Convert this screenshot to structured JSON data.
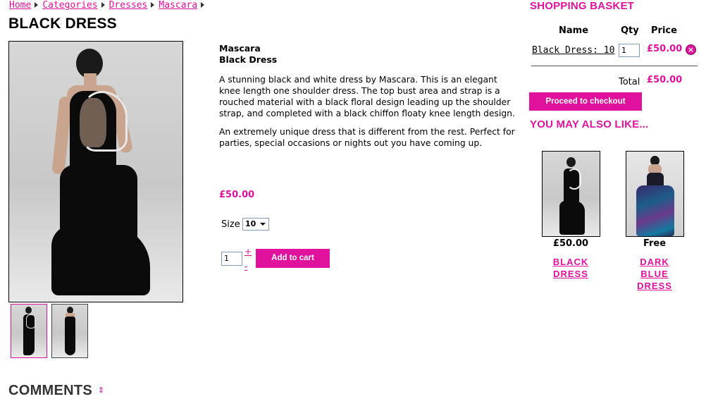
{
  "breadcrumb": {
    "items": [
      "Home",
      "Categories",
      "Dresses",
      "Mascara"
    ]
  },
  "page_title": "BLACK DRESS",
  "product": {
    "brand": "Mascara",
    "name": "Black Dress",
    "description": [
      "A stunning black and white dress by Mascara. This is an elegant knee length one shoulder dress. The top bust area and strap is a rouched material with a black floral design leading up the shoulder strap, and completed with a black chiffon floaty knee length design.",
      "An extremely unique dress that is different from the rest. Perfect for parties, special occasions or nights out you have coming up."
    ],
    "price": "£50.00",
    "size_label": "Size",
    "size_selected": "10",
    "quantity": "1",
    "qty_plus": "+",
    "qty_minus": "-",
    "add_to_cart_label": "Add to cart"
  },
  "comments": {
    "title": "COMMENTS",
    "toggle_icon": "⇕"
  },
  "basket": {
    "title": "SHOPPING BASKET",
    "columns": [
      "Name",
      "Qty",
      "Price"
    ],
    "items": [
      {
        "name": "Black Dress: 10",
        "qty": "1",
        "price": "£50.00"
      }
    ],
    "total_label": "Total",
    "total_value": "£50.00",
    "checkout_label": "Proceed to checkout"
  },
  "also_like": {
    "title": "YOU MAY ALSO LIKE...",
    "items": [
      {
        "price": "£50.00",
        "name_lines": [
          "BLACK",
          "DRESS"
        ]
      },
      {
        "price": "Free",
        "name_lines": [
          "DARK",
          "BLUE",
          "DRESS"
        ]
      }
    ]
  },
  "colors": {
    "accent": "#e0119d",
    "text": "#000000",
    "background": "#ffffff"
  },
  "icons": {
    "breadcrumb_separator": "triangle-right-icon",
    "remove": "remove-circle-icon",
    "comments_toggle": "expand-toggle-icon"
  }
}
